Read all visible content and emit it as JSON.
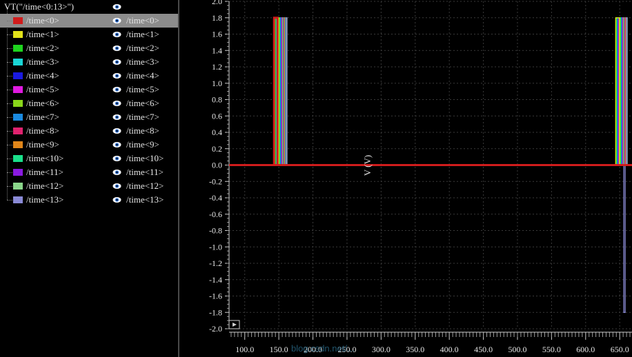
{
  "panel": {
    "root_label": "VT(\"/time<0:13>\")",
    "signals": [
      {
        "name": "/time<0>",
        "alias": "/time<0>",
        "color": "#d01c1c"
      },
      {
        "name": "/time<1>",
        "alias": "/time<1>",
        "color": "#e2e21a"
      },
      {
        "name": "/time<2>",
        "alias": "/time<2>",
        "color": "#1ed41e"
      },
      {
        "name": "/time<3>",
        "alias": "/time<3>",
        "color": "#1ad6d6"
      },
      {
        "name": "/time<4>",
        "alias": "/time<4>",
        "color": "#1a1ae0"
      },
      {
        "name": "/time<5>",
        "alias": "/time<5>",
        "color": "#e01ae0"
      },
      {
        "name": "/time<6>",
        "alias": "/time<6>",
        "color": "#8ad61a"
      },
      {
        "name": "/time<7>",
        "alias": "/time<7>",
        "color": "#1a8ae0"
      },
      {
        "name": "/time<8>",
        "alias": "/time<8>",
        "color": "#e0226e"
      },
      {
        "name": "/time<9>",
        "alias": "/time<9>",
        "color": "#e0861a"
      },
      {
        "name": "/time<10>",
        "alias": "/time<10>",
        "color": "#1ae08a"
      },
      {
        "name": "/time<11>",
        "alias": "/time<11>",
        "color": "#8a1ae0"
      },
      {
        "name": "/time<12>",
        "alias": "/time<12>",
        "color": "#8ad68a"
      },
      {
        "name": "/time<13>",
        "alias": "/time<13>",
        "color": "#8a8ad6"
      }
    ],
    "icons": {
      "visibility": "eye-icon"
    }
  },
  "chart_data": {
    "type": "line",
    "xlabel": "",
    "ylabel": "V (V)",
    "xlim": [
      77,
      668
    ],
    "ylim": [
      -2.0,
      2.0
    ],
    "x_ticks": [
      "100.0",
      "150.0",
      "200.0",
      "250.0",
      "300.0",
      "350.0",
      "400.0",
      "450.0",
      "500.0",
      "550.0",
      "600.0",
      "650.0"
    ],
    "y_ticks": [
      "2.0",
      "1.8",
      "1.6",
      "1.4",
      "1.2",
      "1.0",
      "0.8",
      "0.6",
      "0.4",
      "0.2",
      "0.0",
      "-0.2",
      "-0.4",
      "-0.6",
      "-0.8",
      "-1.0",
      "-1.2",
      "-1.4",
      "-1.6",
      "-1.8",
      "-2.0"
    ],
    "grid": true,
    "watermark": "blog.csdn.net/...",
    "series_note_colors": "same order as panel.signals",
    "series": [
      {
        "values_x": [
          77,
          143,
          143,
          148,
          148,
          668
        ],
        "values_y": [
          0,
          0,
          1.8,
          1.8,
          0,
          0
        ]
      },
      {
        "values_x": [
          77,
          144,
          144,
          150,
          150,
          644,
          644,
          650,
          650,
          668
        ],
        "values_y": [
          0,
          0,
          1.8,
          1.8,
          0,
          0,
          1.8,
          1.8,
          0,
          0
        ]
      },
      {
        "values_x": [
          77,
          145,
          145,
          151,
          151,
          645,
          645,
          651,
          651,
          668
        ],
        "values_y": [
          0,
          0,
          1.8,
          1.8,
          0,
          0,
          1.8,
          1.8,
          0,
          0
        ]
      },
      {
        "values_x": [
          77,
          146,
          146,
          152,
          152,
          646,
          646,
          652,
          652,
          668
        ],
        "values_y": [
          0,
          0,
          1.8,
          1.8,
          0,
          0,
          1.8,
          1.8,
          0,
          0
        ]
      },
      {
        "values_x": [
          77,
          147,
          147,
          153,
          153,
          647,
          647,
          653,
          653,
          668
        ],
        "values_y": [
          0,
          0,
          1.8,
          1.8,
          0,
          0,
          1.8,
          1.8,
          0,
          0
        ]
      },
      {
        "values_x": [
          77,
          148,
          148,
          154,
          154,
          648,
          648,
          654,
          654,
          668
        ],
        "values_y": [
          0,
          0,
          1.8,
          1.8,
          0,
          0,
          1.8,
          1.8,
          0,
          0
        ]
      },
      {
        "values_x": [
          77,
          149,
          149,
          155,
          155,
          649,
          649,
          655,
          655,
          668
        ],
        "values_y": [
          0,
          0,
          1.8,
          1.8,
          0,
          0,
          1.8,
          1.8,
          0,
          0
        ]
      },
      {
        "values_x": [
          77,
          150,
          150,
          156,
          156,
          650,
          650,
          656,
          656,
          668
        ],
        "values_y": [
          0,
          0,
          1.8,
          1.8,
          0,
          0,
          1.8,
          1.8,
          0,
          0
        ]
      },
      {
        "values_x": [
          77,
          151,
          151,
          157,
          157,
          651,
          651,
          657,
          657,
          668
        ],
        "values_y": [
          0,
          0,
          1.8,
          1.8,
          0,
          0,
          1.8,
          1.8,
          0,
          0
        ]
      },
      {
        "values_x": [
          77,
          152,
          152,
          158,
          158,
          652,
          652,
          658,
          658,
          668
        ],
        "values_y": [
          0,
          0,
          1.8,
          1.8,
          0,
          0,
          1.8,
          1.8,
          0,
          0
        ]
      },
      {
        "values_x": [
          77,
          153,
          153,
          159,
          159,
          653,
          653,
          658,
          658,
          668
        ],
        "values_y": [
          0,
          0,
          1.8,
          1.8,
          0,
          0,
          1.8,
          1.8,
          0,
          0
        ]
      },
      {
        "values_x": [
          77,
          154,
          154,
          160,
          160,
          654,
          654,
          659,
          659,
          668
        ],
        "values_y": [
          0,
          0,
          1.8,
          1.8,
          0,
          0,
          1.8,
          1.8,
          0,
          0
        ]
      },
      {
        "values_x": [
          77,
          155,
          155,
          161,
          161,
          655,
          655,
          660,
          660,
          668
        ],
        "values_y": [
          0,
          0,
          1.8,
          1.8,
          0,
          0,
          1.8,
          1.8,
          0,
          0
        ]
      },
      {
        "values_x": [
          77,
          156,
          156,
          162,
          162,
          656,
          656,
          661,
          661,
          668
        ],
        "values_y": [
          0,
          0,
          1.8,
          1.8,
          0,
          0,
          1.8,
          1.8,
          0,
          0
        ]
      },
      {
        "values_x": [
          656,
          656,
          658,
          658,
          668
        ],
        "values_y": [
          0,
          -1.8,
          -1.8,
          0,
          0
        ]
      }
    ]
  }
}
